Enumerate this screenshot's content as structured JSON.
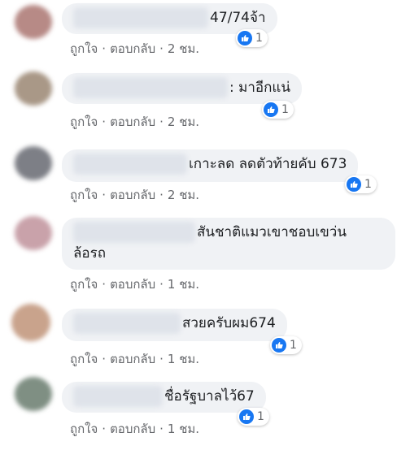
{
  "actions": {
    "like": "ถูกใจ",
    "reply": "ตอบกลับ",
    "sep": "·"
  },
  "comments": [
    {
      "text": "47/74จ้า",
      "time": "2 ชม.",
      "reactions": "1"
    },
    {
      "text": ": มาอีกแน่",
      "time": "2 ชม.",
      "reactions": "1"
    },
    {
      "text": "เกาะลด ลดตัวท้ายคับ 673",
      "time": "2 ชม.",
      "reactions": "1"
    },
    {
      "text_line1": "สันชาติแมวเขาชอบเขว่น",
      "text_line2": "ล้อรถ",
      "time": "1 ชม."
    },
    {
      "text": "สวยครับผม674",
      "time": "1 ชม.",
      "reactions": "1"
    },
    {
      "text": "ชื่อรัฐบาลไว้67",
      "time": "1 ชม.",
      "reactions": "1"
    }
  ],
  "colors": {
    "accent": "#1877f2",
    "bubble": "#f0f2f5",
    "meta": "#65676b"
  },
  "icons": {
    "reaction": "like-icon"
  }
}
